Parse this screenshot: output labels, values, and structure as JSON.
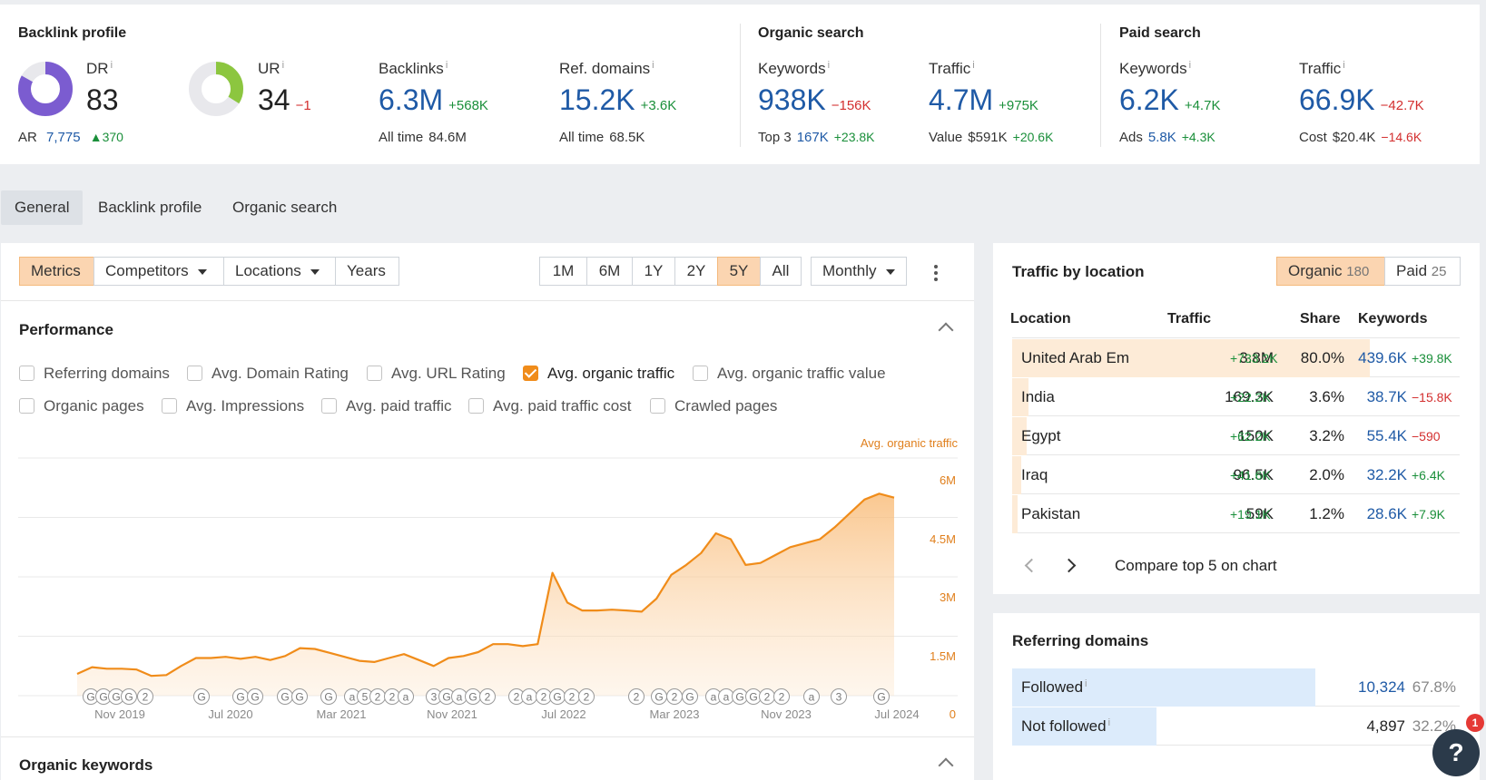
{
  "top": {
    "backlink_profile": {
      "title": "Backlink profile",
      "dr": {
        "label": "DR",
        "info": "i",
        "value": "83",
        "ring_fill": 0.83,
        "ring_color": "#7b5cd0"
      },
      "ar": {
        "label": "AR",
        "value": "7,775",
        "delta": "370"
      },
      "ur": {
        "label": "UR",
        "info": "i",
        "value": "34",
        "delta": "−1",
        "ring_fill": 0.34,
        "ring_color": "#8cc63f"
      },
      "backlinks": {
        "label": "Backlinks",
        "info": "i",
        "value": "6.3M",
        "delta": "+568K",
        "sub_label": "All time",
        "sub_value": "84.6M"
      },
      "ref_domains": {
        "label": "Ref. domains",
        "info": "i",
        "value": "15.2K",
        "delta": "+3.6K",
        "sub_label": "All time",
        "sub_value": "68.5K"
      }
    },
    "organic_search": {
      "title": "Organic search",
      "keywords": {
        "label": "Keywords",
        "info": "i",
        "value": "938K",
        "delta": "−156K",
        "sub_label": "Top 3",
        "sub_value": "167K",
        "sub_delta": "+23.8K"
      },
      "traffic": {
        "label": "Traffic",
        "info": "i",
        "value": "4.7M",
        "delta": "+975K",
        "sub_label": "Value",
        "sub_value": "$591K",
        "sub_delta": "+20.6K"
      }
    },
    "paid_search": {
      "title": "Paid search",
      "keywords": {
        "label": "Keywords",
        "info": "i",
        "value": "6.2K",
        "delta": "+4.7K",
        "sub_label": "Ads",
        "sub_value": "5.8K",
        "sub_delta": "+4.3K"
      },
      "traffic": {
        "label": "Traffic",
        "info": "i",
        "value": "66.9K",
        "delta": "−42.7K",
        "sub_label": "Cost",
        "sub_value": "$20.4K",
        "sub_delta": "−14.6K"
      }
    }
  },
  "tabs": [
    {
      "label": "General",
      "active": true
    },
    {
      "label": "Backlink profile"
    },
    {
      "label": "Organic search"
    }
  ],
  "toolbar": {
    "metrics": "Metrics",
    "competitors": "Competitors",
    "locations": "Locations",
    "years": "Years",
    "ranges": [
      "1M",
      "6M",
      "1Y",
      "2Y",
      "5Y",
      "All"
    ],
    "active_range": "5Y",
    "interval": "Monthly"
  },
  "performance": {
    "title": "Performance",
    "checkboxes": [
      {
        "label": "Referring domains",
        "checked": false
      },
      {
        "label": "Avg. Domain Rating",
        "checked": false
      },
      {
        "label": "Avg. URL Rating",
        "checked": false
      },
      {
        "label": "Avg. organic traffic",
        "checked": true
      },
      {
        "label": "Avg. organic traffic value",
        "checked": false
      },
      {
        "label": "Organic pages",
        "checked": false
      },
      {
        "label": "Avg. Impressions",
        "checked": false
      },
      {
        "label": "Avg. paid traffic",
        "checked": false
      },
      {
        "label": "Avg. paid traffic cost",
        "checked": false
      },
      {
        "label": "Crawled pages",
        "checked": false
      }
    ],
    "chart": {
      "series_label": "Avg. organic traffic",
      "y_ticks": [
        "6M",
        "4.5M",
        "3M",
        "1.5M",
        "0"
      ],
      "x_ticks": [
        "Nov 2019",
        "Jul 2020",
        "Mar 2021",
        "Nov 2021",
        "Jul 2022",
        "Mar 2023",
        "Nov 2023",
        "Jul 2024"
      ],
      "annotation_markers": [
        "G",
        "G",
        "G",
        "G",
        "2",
        "G",
        "G",
        "G",
        "G",
        "G",
        "G",
        "a",
        "5",
        "2",
        "2",
        "a",
        "3",
        "G",
        "a",
        "G",
        "2",
        "2",
        "a",
        "2",
        "G",
        "2",
        "2",
        "2",
        "G",
        "2",
        "G",
        "a",
        "a",
        "G",
        "G",
        "2",
        "2",
        "a",
        "3",
        "G"
      ]
    }
  },
  "chart_data": {
    "type": "area",
    "series": [
      {
        "name": "Avg. organic traffic",
        "color": "#f08c1a",
        "values": [
          0.55,
          0.72,
          0.68,
          0.68,
          0.66,
          0.5,
          0.52,
          0.75,
          0.95,
          0.95,
          0.98,
          0.93,
          0.98,
          0.9,
          1.0,
          1.2,
          1.18,
          1.08,
          0.98,
          0.88,
          0.85,
          0.95,
          1.05,
          0.9,
          0.75,
          0.95,
          1.0,
          1.1,
          1.3,
          1.3,
          1.25,
          1.3,
          3.1,
          2.35,
          2.15,
          2.15,
          2.17,
          2.15,
          2.12,
          2.45,
          3.05,
          3.3,
          3.6,
          4.1,
          3.95,
          3.3,
          3.35,
          3.55,
          3.75,
          3.85,
          3.95,
          4.25,
          4.6,
          4.95,
          5.1,
          5.0
        ]
      }
    ],
    "x_range": [
      "Nov 2019",
      "Jul 2024"
    ],
    "ylim": [
      0,
      6000000
    ],
    "y_unit": "M",
    "grid": true
  },
  "organic_keywords": {
    "title": "Organic keywords"
  },
  "traffic_by_location": {
    "title": "Traffic by location",
    "toggle": [
      {
        "label": "Organic",
        "count": "180",
        "active": true
      },
      {
        "label": "Paid",
        "count": "25"
      }
    ],
    "columns": [
      "Location",
      "Traffic",
      "Share",
      "Keywords"
    ],
    "rows": [
      {
        "location": "United Arab Em",
        "traffic": "3.8M",
        "traffic_delta": "+733.2K",
        "share": "80.0%",
        "share_fraction": 0.8,
        "keywords": "439.6K",
        "kw_delta": "+39.8K",
        "kw_delta_sign": "pos"
      },
      {
        "location": "India",
        "traffic": "169.3K",
        "traffic_delta": "+22.2K",
        "share": "3.6%",
        "share_fraction": 0.036,
        "keywords": "38.7K",
        "kw_delta": "−15.8K",
        "kw_delta_sign": "neg"
      },
      {
        "location": "Egypt",
        "traffic": "150K",
        "traffic_delta": "+62.2K",
        "share": "3.2%",
        "share_fraction": 0.032,
        "keywords": "55.4K",
        "kw_delta": "−590",
        "kw_delta_sign": "neg"
      },
      {
        "location": "Iraq",
        "traffic": "96.5K",
        "traffic_delta": "+41.6K",
        "share": "2.0%",
        "share_fraction": 0.02,
        "keywords": "32.2K",
        "kw_delta": "+6.4K",
        "kw_delta_sign": "pos"
      },
      {
        "location": "Pakistan",
        "traffic": "59K",
        "traffic_delta": "+19.1K",
        "share": "1.2%",
        "share_fraction": 0.012,
        "keywords": "28.6K",
        "kw_delta": "+7.9K",
        "kw_delta_sign": "pos"
      }
    ],
    "compare_label": "Compare top 5 on chart"
  },
  "referring_domains": {
    "title": "Referring domains",
    "rows": [
      {
        "label": "Followed",
        "info": "i",
        "value": "10,324",
        "share": "67.8%",
        "fraction": 0.678
      },
      {
        "label": "Not followed",
        "info": "i",
        "value": "4,897",
        "share": "32.2%",
        "fraction": 0.322
      }
    ]
  },
  "help": {
    "label": "?",
    "badge": "1"
  },
  "colors": {
    "accent": "#f08c1a",
    "link_blue": "#1f5aa6",
    "positive": "#1a8f3a",
    "negative": "#d32f2f"
  }
}
